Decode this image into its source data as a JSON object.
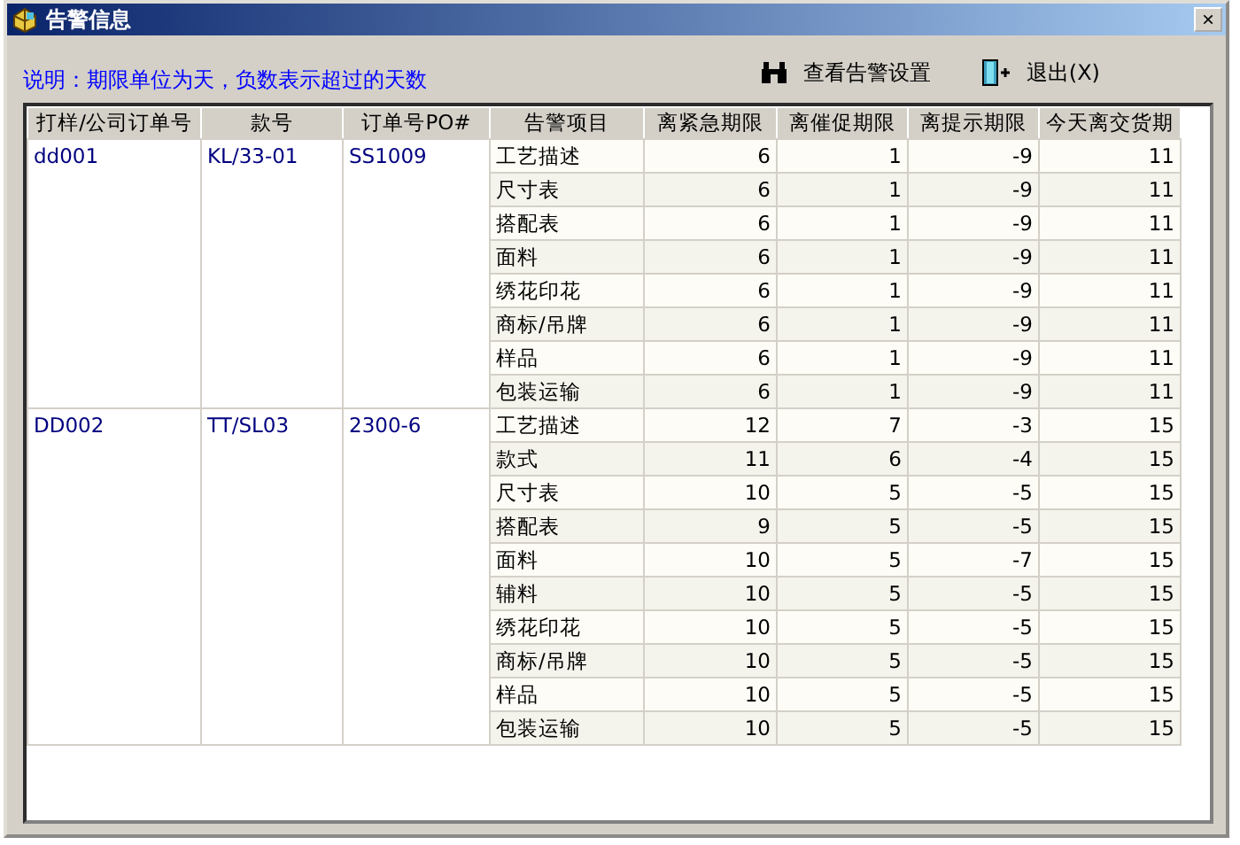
{
  "window": {
    "title": "告警信息",
    "close": "×"
  },
  "note": "说明：期限单位为天，负数表示超过的天数",
  "toolbar": [
    {
      "kind": "binoculars",
      "label": "查看告警设置"
    },
    {
      "kind": "exit",
      "label": "退出(X)"
    }
  ],
  "table": {
    "columns": [
      "打样/公司订单号",
      "款号",
      "订单号PO#",
      "告警项目",
      "离紧急期限",
      "离催促期限",
      "离提示期限",
      "今天离交货期"
    ],
    "groups": [
      {
        "order": "dd001",
        "style": "KL/33-01",
        "po": "SS1009",
        "rows": [
          [
            "工艺描述",
            "6",
            "1",
            "-9",
            "11"
          ],
          [
            "尺寸表",
            "6",
            "1",
            "-9",
            "11"
          ],
          [
            "搭配表",
            "6",
            "1",
            "-9",
            "11"
          ],
          [
            "面料",
            "6",
            "1",
            "-9",
            "11"
          ],
          [
            "绣花印花",
            "6",
            "1",
            "-9",
            "11"
          ],
          [
            "商标/吊牌",
            "6",
            "1",
            "-9",
            "11"
          ],
          [
            "样品",
            "6",
            "1",
            "-9",
            "11"
          ],
          [
            "包装运输",
            "6",
            "1",
            "-9",
            "11"
          ]
        ]
      },
      {
        "order": "DD002",
        "style": "TT/SL03",
        "po": "2300-6",
        "rows": [
          [
            "工艺描述",
            "12",
            "7",
            "-3",
            "15"
          ],
          [
            "款式",
            "11",
            "6",
            "-4",
            "15"
          ],
          [
            "尺寸表",
            "10",
            "5",
            "-5",
            "15"
          ],
          [
            "搭配表",
            "9",
            "5",
            "-5",
            "15"
          ],
          [
            "面料",
            "10",
            "5",
            "-7",
            "15"
          ],
          [
            "辅料",
            "10",
            "5",
            "-5",
            "15"
          ],
          [
            "绣花印花",
            "10",
            "5",
            "-5",
            "15"
          ],
          [
            "商标/吊牌",
            "10",
            "5",
            "-5",
            "15"
          ],
          [
            "样品",
            "10",
            "5",
            "-5",
            "15"
          ],
          [
            "包装运输",
            "10",
            "5",
            "-5",
            "15"
          ]
        ]
      }
    ]
  }
}
